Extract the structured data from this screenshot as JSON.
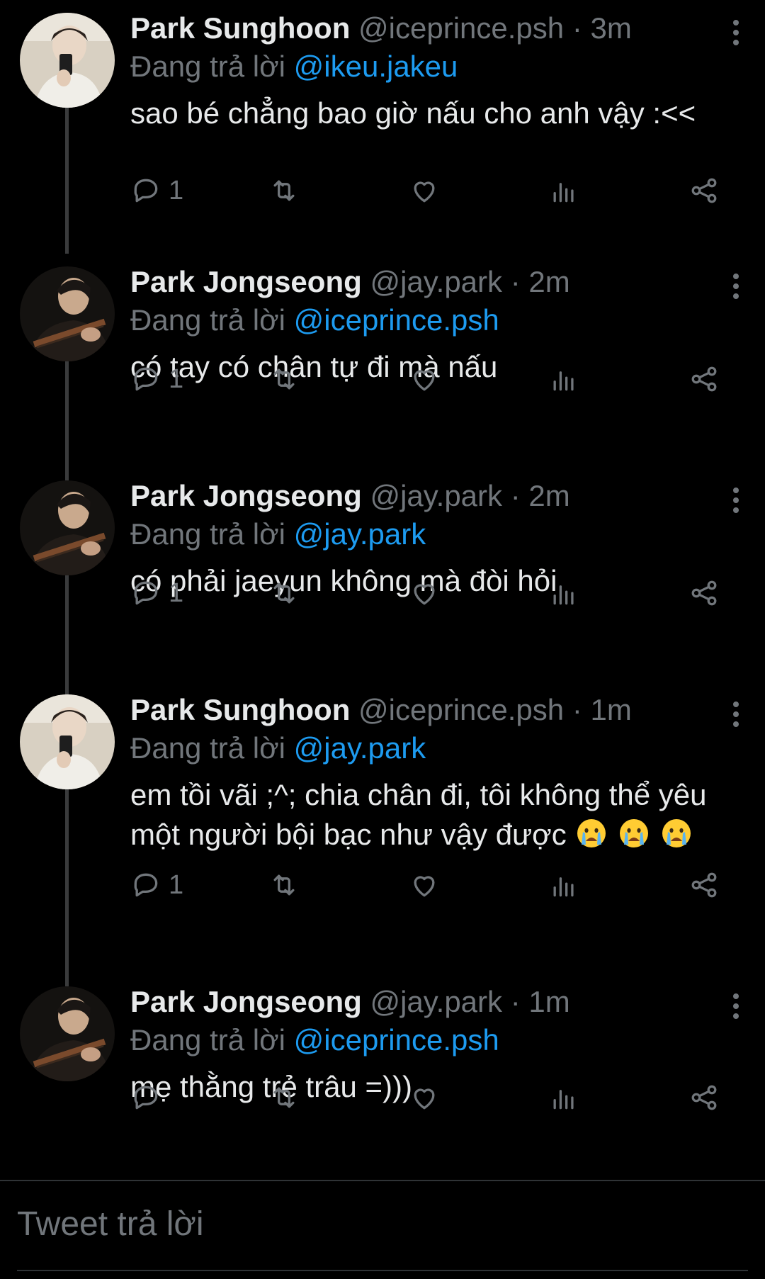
{
  "tweets": [
    {
      "name": "Park Sunghoon",
      "handle": "@iceprince.psh",
      "time": "· 3m",
      "reply_prefix": "Đang trả lời",
      "reply_to": "@ikeu.jakeu",
      "text": "sao bé chẳng bao giờ nấu cho anh vậy :<<",
      "reply_count": "1",
      "avatar": "sunghoon"
    },
    {
      "name": "Park Jongseong",
      "handle": "@jay.park",
      "time": "· 2m",
      "reply_prefix": "Đang trả lời",
      "reply_to": "@iceprince.psh",
      "text": "có tay có chân tự đi mà nấu",
      "reply_count": "1",
      "avatar": "jongseong"
    },
    {
      "name": "Park Jongseong",
      "handle": "@jay.park",
      "time": "· 2m",
      "reply_prefix": "Đang trả lời",
      "reply_to": "@jay.park",
      "text": "có phải jaeyun không mà đòi hỏi",
      "reply_count": "1",
      "avatar": "jongseong"
    },
    {
      "name": "Park Sunghoon",
      "handle": "@iceprince.psh",
      "time": "· 1m",
      "reply_prefix": "Đang trả lời",
      "reply_to": "@jay.park",
      "text": "em tồi vãi ;^; chia chân đi, tôi không thể yêu một người bội bạc như vậy được",
      "emoji": "crying-face",
      "reply_count": "1",
      "avatar": "sunghoon"
    },
    {
      "name": "Park Jongseong",
      "handle": "@jay.park",
      "time": "· 1m",
      "reply_prefix": "Đang trả lời",
      "reply_to": "@iceprince.psh",
      "text": "mẹ thằng trẻ trâu =)))",
      "reply_count": "",
      "avatar": "jongseong"
    }
  ],
  "compose": {
    "placeholder": "Tweet trả lời"
  },
  "colors": {
    "background": "#000000",
    "text": "#e7e9ea",
    "muted": "#71767b",
    "link": "#1d9bf0",
    "thread_line": "#3a3b3c"
  }
}
